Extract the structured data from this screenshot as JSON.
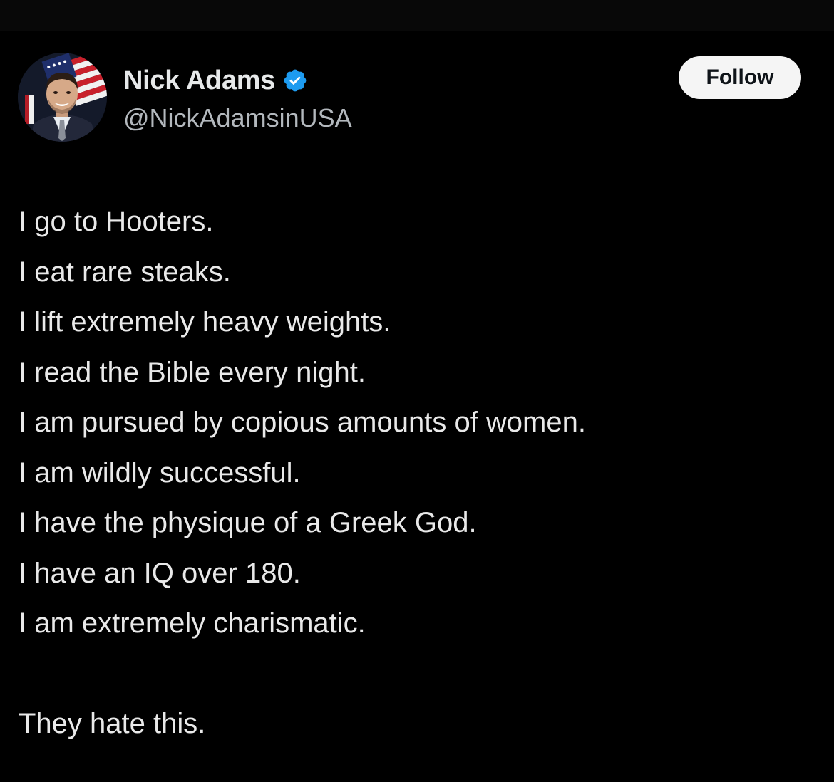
{
  "author": {
    "display_name": "Nick Adams",
    "handle": "@NickAdamsinUSA",
    "verified": true,
    "verified_badge_color": "#1d9bf0",
    "avatar_icon": "profile-photo-avatar"
  },
  "actions": {
    "follow_label": "Follow"
  },
  "post": {
    "lines": [
      "I go to Hooters.",
      "I eat rare steaks.",
      "I lift extremely heavy weights.",
      "I read the Bible every night.",
      "I am pursued by copious amounts of women.",
      "I am wildly successful.",
      "I have the physique of a Greek God.",
      "I have an IQ over 180.",
      "I am extremely charismatic."
    ],
    "closing": "They hate this."
  },
  "colors": {
    "background": "#000000",
    "text": "#e7e9ea",
    "secondary_text": "#b3b8bd",
    "follow_button_bg": "#f5f5f5"
  }
}
